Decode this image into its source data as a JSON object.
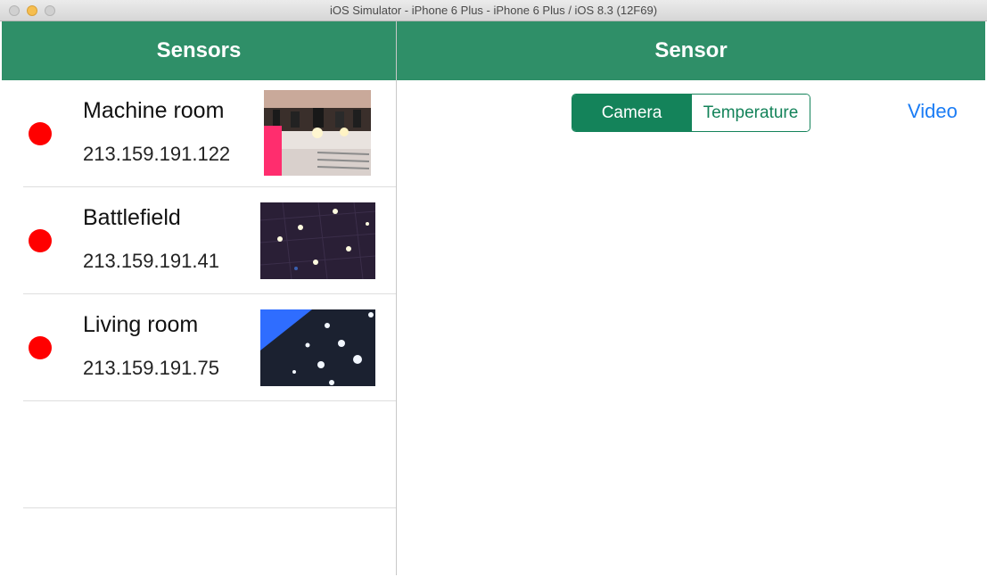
{
  "window": {
    "title": "iOS Simulator - iPhone 6 Plus - iPhone 6 Plus / iOS 8.3 (12F69)"
  },
  "master": {
    "title": "Sensors"
  },
  "detail": {
    "title": "Sensor",
    "segments": [
      "Camera",
      "Temperature"
    ],
    "selected_segment": "Camera",
    "video_link": "Video"
  },
  "sensors": [
    {
      "name": "Machine room",
      "ip": "213.159.191.122",
      "status_color": "#ff0000"
    },
    {
      "name": "Battlefield",
      "ip": "213.159.191.41",
      "status_color": "#ff0000"
    },
    {
      "name": "Living room",
      "ip": "213.159.191.75",
      "status_color": "#ff0000"
    }
  ],
  "colors": {
    "nav_bar": "#2f8f68",
    "segment_tint": "#14835a",
    "link": "#1a7cf5",
    "status_offline": "#ff0000"
  }
}
